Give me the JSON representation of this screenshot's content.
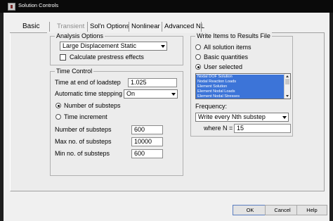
{
  "window": {
    "title": "Solution Controls"
  },
  "tabs": [
    {
      "label": "Basic",
      "state": "selected"
    },
    {
      "label": "Transient",
      "state": "disabled"
    },
    {
      "label": "Sol'n Options",
      "state": "normal"
    },
    {
      "label": "Nonlinear",
      "state": "normal"
    },
    {
      "label": "Advanced NL",
      "state": "normal"
    }
  ],
  "analysis_options": {
    "title": "Analysis Options",
    "analysis_type": "Large Displacement Static",
    "prestress_label": "Calculate prestress effects",
    "prestress_checked": false
  },
  "time_control": {
    "title": "Time Control",
    "end_time_label": "Time at end of loadstep",
    "end_time_value": "1.025",
    "auto_stepping_label": "Automatic time stepping",
    "auto_stepping_value": "On",
    "num_substeps_radio": "Number of substeps",
    "time_increment_radio": "Time increment",
    "selected_mode": "Number of substeps",
    "num_substeps_label": "Number of substeps",
    "num_substeps_value": "600",
    "max_substeps_label": "Max no. of substeps",
    "max_substeps_value": "10000",
    "min_substeps_label": "Min no. of substeps",
    "min_substeps_value": "600"
  },
  "results_file": {
    "title": "Write Items to Results File",
    "options": [
      "All solution items",
      "Basic quantities",
      "User selected"
    ],
    "selected_option": "User selected",
    "items": [
      "Nodal DOF Solution",
      "Nodal Reaction Loads",
      "Element Solution",
      "Element Nodal Loads",
      "Element Nodal Stresses"
    ],
    "frequency_label": "Frequency:",
    "frequency_value": "Write every Nth substep",
    "n_label": "where N =",
    "n_value": "15"
  },
  "buttons": {
    "ok": "OK",
    "cancel": "Cancel",
    "help": "Help"
  },
  "colors": {
    "titlebar": "#0a0a0a",
    "dialog_bg": "#f0f0f0",
    "list_selection": "#3c74d8"
  }
}
